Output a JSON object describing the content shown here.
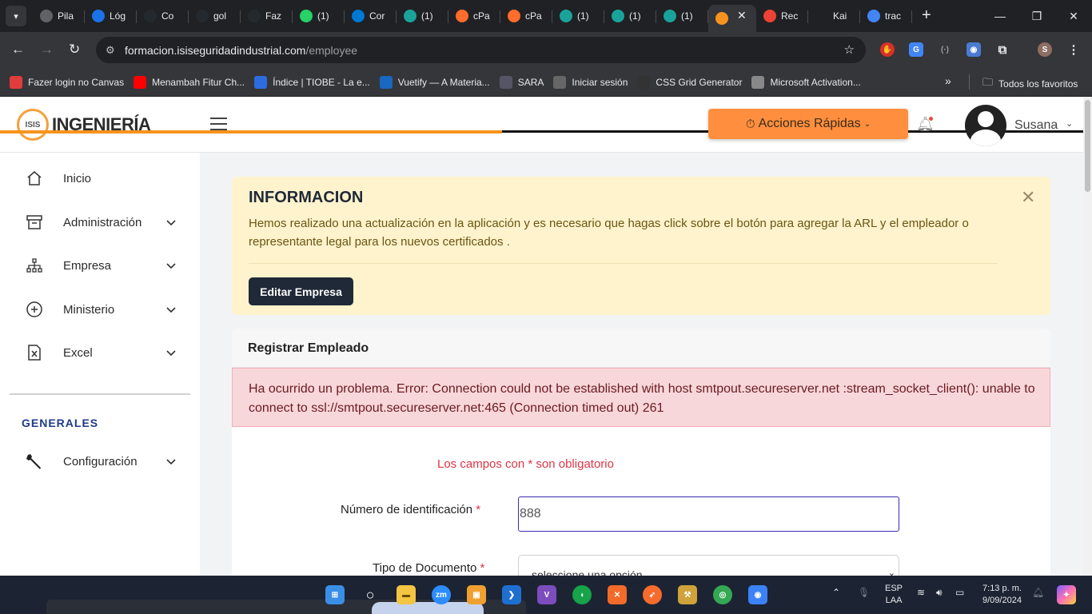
{
  "browser": {
    "tabs": [
      {
        "label": "Pila",
        "icon": "globe-icon",
        "color": "#5f6368"
      },
      {
        "label": "Lóg",
        "icon": "drive-icon",
        "color": "#1a73e8"
      },
      {
        "label": "Co",
        "icon": "github-icon",
        "color": "#24292f"
      },
      {
        "label": "gol",
        "icon": "github-icon",
        "color": "#24292f"
      },
      {
        "label": "Faz",
        "icon": "github-icon",
        "color": "#24292f"
      },
      {
        "label": "(1)",
        "icon": "whatsapp-icon",
        "color": "#25d366"
      },
      {
        "label": "Cor",
        "icon": "outlook-icon",
        "color": "#0078d4"
      },
      {
        "label": "(1)",
        "icon": "teal-app-icon",
        "color": "#1aa39a"
      },
      {
        "label": "cPa",
        "icon": "cpanel-icon",
        "color": "#ff6c2c"
      },
      {
        "label": "cPa",
        "icon": "cpanel-icon",
        "color": "#ff6c2c"
      },
      {
        "label": "(1)",
        "icon": "teal-app-icon",
        "color": "#1aa39a"
      },
      {
        "label": "(1)",
        "icon": "teal-app-icon",
        "color": "#1aa39a"
      },
      {
        "label": "(1)",
        "icon": "teal-app-icon",
        "color": "#1aa39a"
      }
    ],
    "active_tab": {
      "label": "",
      "icon": "isis-icon",
      "color": "#f7931e"
    },
    "after_tabs": [
      {
        "label": "Rec",
        "icon": "gmail-icon",
        "color": "#ea4335"
      },
      {
        "label": "Kai",
        "icon": "blank-icon",
        "color": "#202124"
      },
      {
        "label": "trac",
        "icon": "google-icon",
        "color": "#4285f4"
      }
    ],
    "url_domain": "formacion.isiseguridadindustrial.com",
    "url_path": "/employee",
    "bookmarks": [
      {
        "label": "Fazer login no Canvas",
        "color": "#e13c3c"
      },
      {
        "label": "Menambah Fitur Ch...",
        "color": "#ff0000"
      },
      {
        "label": "Índice | TIOBE - La e...",
        "color": "#2d6cdf"
      },
      {
        "label": "Vuetify — A Materia...",
        "color": "#1867c0"
      },
      {
        "label": "SARA",
        "color": "#556"
      },
      {
        "label": "Iniciar sesión",
        "color": "#666"
      },
      {
        "label": "CSS Grid Generator",
        "color": "#333"
      },
      {
        "label": "Microsoft Activation...",
        "color": "#888"
      }
    ],
    "all_favorites": "Todos los favoritos"
  },
  "app": {
    "logo_mark": "ISIS",
    "logo_text": "INGENIERÍA",
    "quick_actions": "Acciones Rápidas",
    "user_name": "Susana"
  },
  "sidebar": {
    "items": [
      {
        "label": "Inicio"
      },
      {
        "label": "Administración"
      },
      {
        "label": "Empresa"
      },
      {
        "label": "Ministerio"
      },
      {
        "label": "Excel"
      }
    ],
    "section_title": "GENERALES",
    "settings_label": "Configuración"
  },
  "info": {
    "title": "INFORMACION",
    "text": "Hemos realizado una actualización en la aplicación y es necesario que hagas click sobre el botón para agregar la ARL y el empleador o representante legal para los nuevos certificados .",
    "button": "Editar Empresa"
  },
  "form": {
    "card_title": "Registrar Empleado",
    "error": "Ha ocurrido un problema. Error: Connection could not be established with host smtpout.secureserver.net :stream_socket_client(): unable to connect to ssl://smtpout.secureserver.net:465 (Connection timed out) 261",
    "required_note": "Los campos con * son obligatorio",
    "id_label": "Número de identificación",
    "id_value": "888",
    "doc_label": "Tipo de Documento",
    "doc_placeholder": "seleccione una opción",
    "required_mark": "*"
  },
  "taskbar": {
    "lang_1": "ESP",
    "lang_2": "LAA",
    "time": "7:13 p. m.",
    "date": "9/09/2024"
  },
  "colors": {
    "accent_orange": "#f7931e",
    "quick_button": "#ff8f3e",
    "nav_text": "#1e3a8a",
    "alert_bg": "#f8d7da",
    "info_bg": "#fff3cd"
  }
}
